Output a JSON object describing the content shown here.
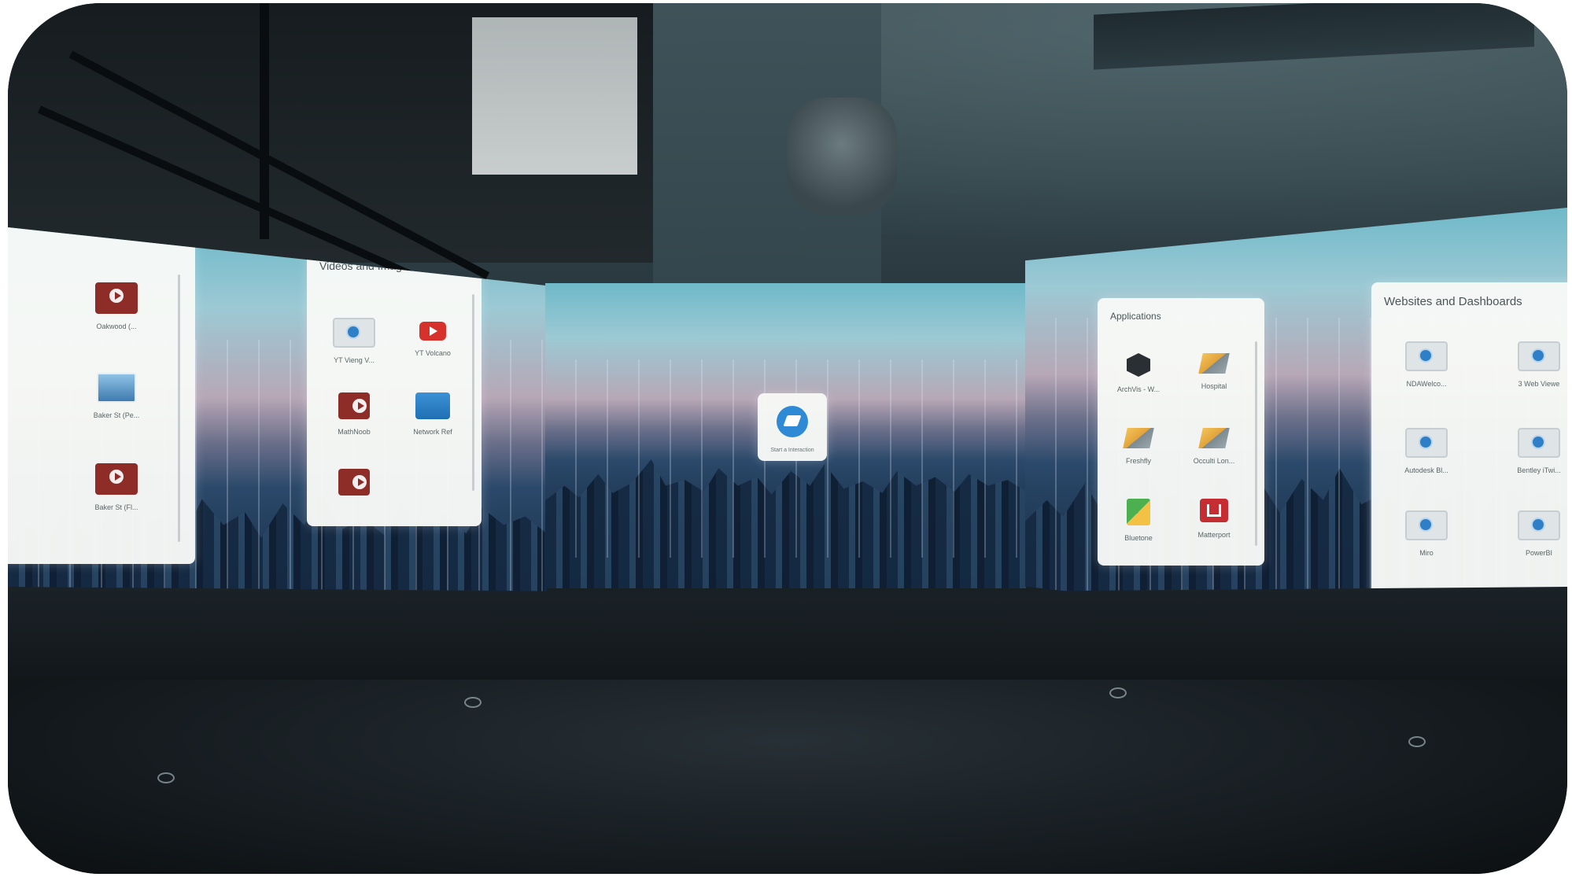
{
  "left_screen": {
    "partial_panel": {
      "tiles": [
        {
          "icon": "video-icon",
          "label": "Oakwood (..."
        },
        {
          "icon": "photo-icon",
          "label": "Baker St (Pe..."
        },
        {
          "icon": "video-icon",
          "label": "Baker St (Fl..."
        }
      ]
    },
    "videos_panel": {
      "title": "Videos and Images",
      "tiles": [
        {
          "icon": "web-icon",
          "label": "YT Vieng V..."
        },
        {
          "icon": "youtube-icon",
          "label": "YT Volcano"
        },
        {
          "icon": "video-icon",
          "label": "MathNoob"
        },
        {
          "icon": "folder-icon",
          "label": "Network Ref"
        },
        {
          "icon": "video-icon",
          "label": ""
        }
      ]
    }
  },
  "center_screen": {
    "launcher_icon": "layers-icon",
    "launcher_label": "Start a Interaction"
  },
  "right_screen": {
    "applications_panel": {
      "title": "Applications",
      "tiles": [
        {
          "icon": "unity-icon",
          "label": "ArchVis - W..."
        },
        {
          "icon": "app-icon",
          "label": "Hospital"
        },
        {
          "icon": "app-icon",
          "label": "Freshfly"
        },
        {
          "icon": "app-icon",
          "label": "Occulti Lon..."
        },
        {
          "icon": "map-icon",
          "label": "Bluetone"
        },
        {
          "icon": "matterport-icon",
          "label": "Matterport"
        }
      ]
    },
    "websites_panel": {
      "title": "Websites and Dashboards",
      "tiles": [
        {
          "icon": "web-icon",
          "label": "NDAWelco..."
        },
        {
          "icon": "web-icon",
          "label": "3 Web Viewe"
        },
        {
          "icon": "web-icon",
          "label": "Autodesk Bl..."
        },
        {
          "icon": "web-icon",
          "label": "Bentley iTwi..."
        },
        {
          "icon": "web-icon",
          "label": "Miro"
        },
        {
          "icon": "web-icon",
          "label": "PowerBI"
        }
      ]
    }
  },
  "colors": {
    "panel_bg": "#f7f9f6",
    "video_red": "#8e2c27",
    "web_blue": "#2f7fc7"
  }
}
